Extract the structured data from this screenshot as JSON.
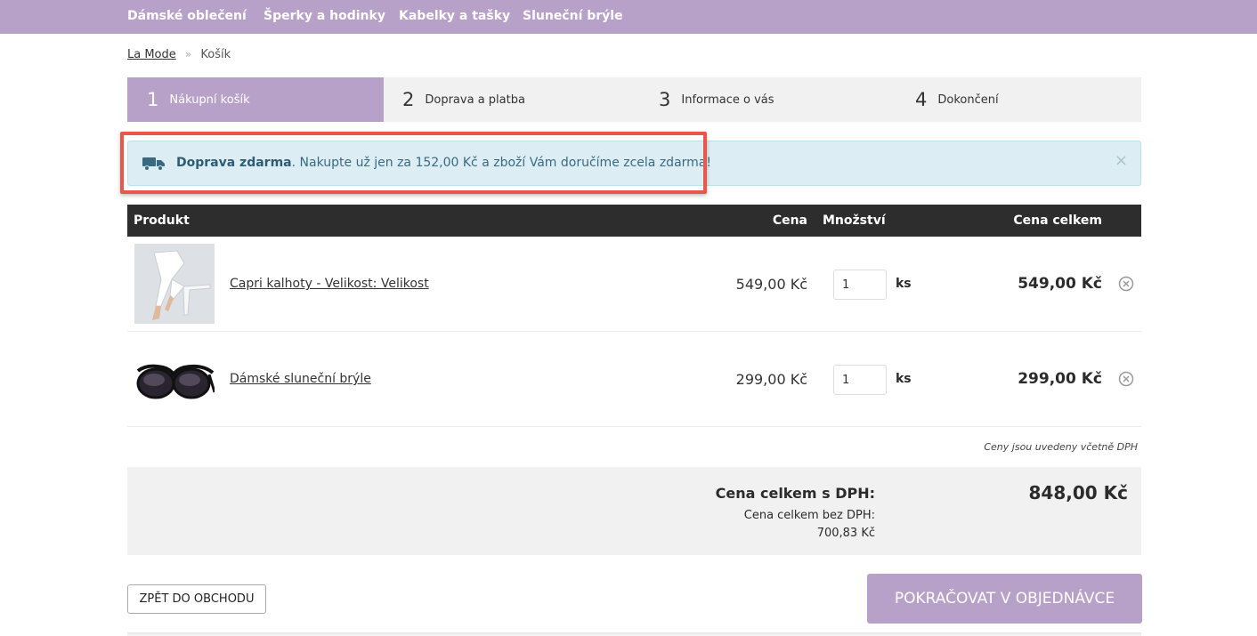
{
  "nav": {
    "items": [
      "Dámské oblečení",
      "Šperky a hodinky",
      "Kabelky a tašky",
      "Sluneční brýle"
    ]
  },
  "breadcrumb": {
    "home": "La Mode",
    "separator": "»",
    "current": "Košík"
  },
  "steps": [
    {
      "num": "1",
      "label": "Nákupní košík"
    },
    {
      "num": "2",
      "label": "Doprava a platba"
    },
    {
      "num": "3",
      "label": "Informace o vás"
    },
    {
      "num": "4",
      "label": "Dokončení"
    }
  ],
  "notice": {
    "bold": "Doprava zdarma",
    "text": ". Nakupte už jen za 152,00 Kč a zboží Vám doručíme zcela zdarma!",
    "close": "×"
  },
  "table": {
    "headers": {
      "product": "Produkt",
      "price": "Cena",
      "quantity": "Množství",
      "total": "Cena celkem"
    },
    "rows": [
      {
        "name": "Capri kalhoty - Velikost: Velikost",
        "price": "549,00 Kč",
        "qty": "1",
        "unit": "ks",
        "total": "549,00 Kč"
      },
      {
        "name": "Dámské sluneční brýle",
        "price": "299,00 Kč",
        "qty": "1",
        "unit": "ks",
        "total": "299,00 Kč"
      }
    ],
    "vat_note": "Ceny jsou uvedeny včetně DPH"
  },
  "summary": {
    "total_vat_label": "Cena celkem s DPH:",
    "total_vat_value": "848,00 Kč",
    "total_novat_label": "Cena celkem bez DPH:",
    "total_novat_value": "700,83 Kč"
  },
  "buttons": {
    "back": "ZPĚT DO OBCHODU",
    "continue": "POKRAČOVAT V OBJEDNÁVCE"
  },
  "colors": {
    "accent": "#b8a1c8",
    "notice_bg": "#dcedf4",
    "highlight": "#e8574a",
    "table_header": "#2d2d2d"
  }
}
